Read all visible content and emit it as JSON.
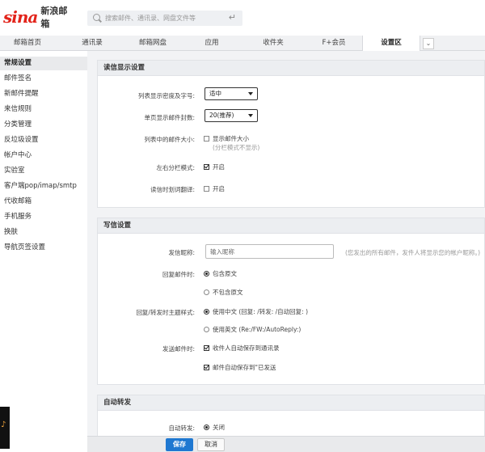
{
  "header": {
    "logo_mark": "sina",
    "logo_text": "新浪邮箱",
    "search_placeholder": "搜索邮件、通讯录、网盘文件等",
    "enter_icon": "↵"
  },
  "nav": {
    "tabs": [
      {
        "label": "邮箱首页"
      },
      {
        "label": "通讯录"
      },
      {
        "label": "邮箱网盘"
      },
      {
        "label": "应用"
      },
      {
        "label": "收件夹"
      },
      {
        "label": "F+会员"
      },
      {
        "label": "设置区",
        "active": true
      }
    ],
    "more_icon": "chevron-down-icon"
  },
  "sidebar": {
    "items": [
      {
        "label": "常规设置",
        "active": true
      },
      {
        "label": "邮件签名"
      },
      {
        "label": "新邮件提醒"
      },
      {
        "label": "来信规则"
      },
      {
        "label": "分类管理"
      },
      {
        "label": "反垃圾设置"
      },
      {
        "label": "帐户中心"
      },
      {
        "label": "实验室"
      },
      {
        "label": "客户端pop/imap/smtp"
      },
      {
        "label": "代收邮箱"
      },
      {
        "label": "手机服务"
      },
      {
        "label": "换肤"
      },
      {
        "label": "导航页签设置"
      }
    ]
  },
  "read_settings": {
    "title": "读信显示设置",
    "density_label": "列表显示密度及字号:",
    "density_value": "适中",
    "per_page_label": "单页显示邮件封数:",
    "per_page_value": "20(推荐)",
    "size_label": "列表中的邮件大小:",
    "size_option": "显示邮件大小",
    "size_hint": "(分栏模式不显示)",
    "split_label": "左右分栏模式:",
    "split_option": "开启",
    "translate_label": "读信时划词翻译:",
    "translate_option": "开启"
  },
  "write_settings": {
    "title": "写信设置",
    "sender_label": "发信昵称:",
    "sender_placeholder": "输入昵称",
    "sender_hint": "(您发出的所有邮件，发件人将显示您的帐户昵称。)",
    "reply_label": "回复邮件时:",
    "reply_option_1": "包含原文",
    "reply_option_2": "不包含原文",
    "subject_label": "回复/转发时主题样式:",
    "subject_option_1": "使用中文 (回复: /转发: /自动回复: )",
    "subject_option_2": "使用英文 (Re:/FW:/AutoReply:)",
    "send_label": "发送邮件时:",
    "send_option_1": "收件人自动保存到通讯录",
    "send_option_2": "邮件自动保存到\"已发送"
  },
  "forward_settings": {
    "title": "自动转发",
    "auto_label": "自动转发:",
    "auto_option": "关闭"
  },
  "footer": {
    "save": "保存",
    "cancel": "取消"
  },
  "music_icon": "♪"
}
